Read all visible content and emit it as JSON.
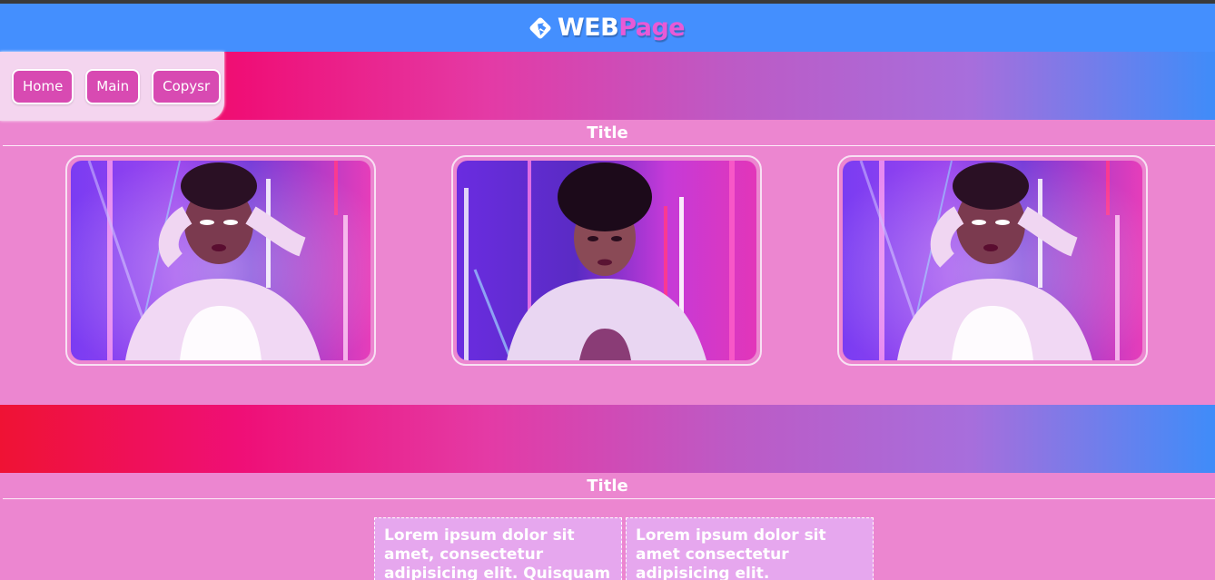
{
  "brand": {
    "word_1": "WEB",
    "word_2": "Page",
    "icon": "diamond-arrow-logo-icon",
    "colors": {
      "word_1": "#ffffff",
      "word_2": "#e85ad7"
    }
  },
  "nav": {
    "items": [
      {
        "label": "Home"
      },
      {
        "label": "Main"
      },
      {
        "label": "Copysr"
      }
    ]
  },
  "sections": [
    {
      "title": "Title"
    },
    {
      "title": "Title"
    }
  ],
  "gallery": {
    "images": [
      {
        "alt": "neon-portrait-hands-on-head"
      },
      {
        "alt": "neon-portrait-looking-forward"
      },
      {
        "alt": "neon-portrait-hands-on-head"
      }
    ]
  },
  "text_boxes": [
    {
      "text": "Lorem ipsum dolor sit amet, consectetur adipisicing elit. Quisquam beatae omnis at"
    },
    {
      "text": "Lorem ipsum dolor sit amet consectetur adipisicing elit. Voluptatum laborum mollitia"
    }
  ],
  "colors": {
    "header": "#448ffe",
    "page_background": "#ec86d0",
    "nav_panel": "#f4d5ef",
    "nav_button": "#d84ab2",
    "gradient_start": "#ef1234",
    "gradient_end": "#3f8cf9"
  }
}
